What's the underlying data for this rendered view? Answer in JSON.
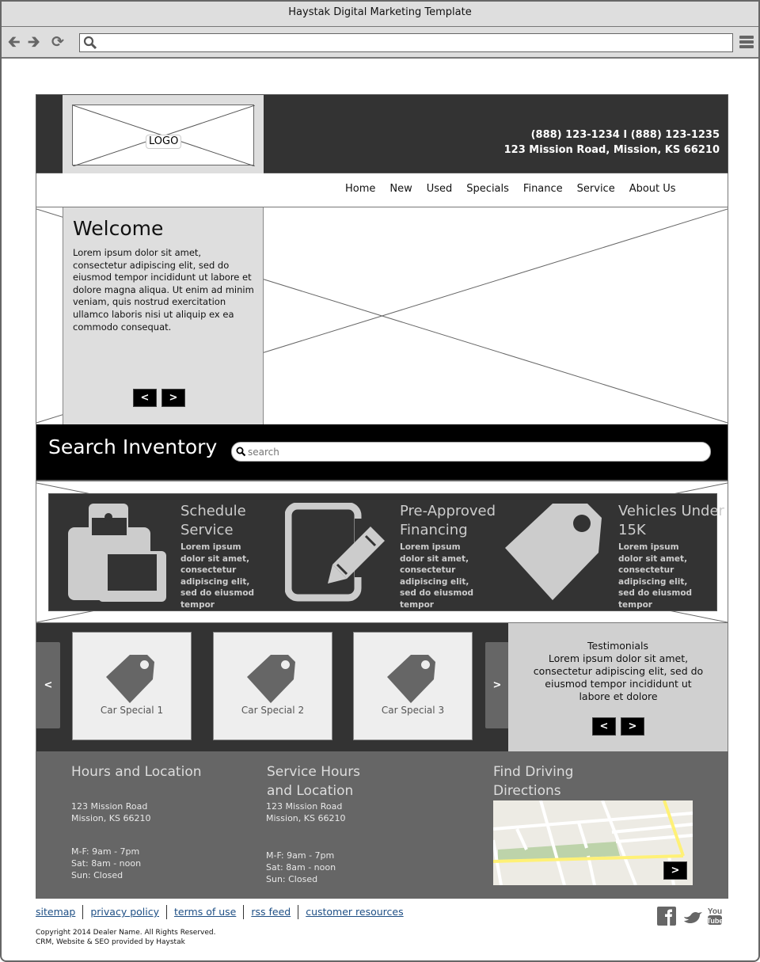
{
  "browser": {
    "title": "Haystak Digital Marketing Template",
    "url": ""
  },
  "header": {
    "logo_label": "LOGO",
    "phone": "(888) 123-1234 I (888) 123-1235",
    "address": "123 Mission Road, Mission, KS 66210"
  },
  "nav": {
    "items": [
      "Home",
      "New",
      "Used",
      "Specials",
      "Finance",
      "Service",
      "About Us"
    ]
  },
  "hero": {
    "title": "Welcome",
    "body": "Lorem ipsum dolor sit amet, consectetur adipiscing elit, sed do eiusmod tempor incididunt ut labore et dolore magna aliqua. Ut enim ad minim veniam, quis nostrud exercitation ullamco laboris nisi ut aliquip ex ea commodo consequat.",
    "prev_label": "<",
    "next_label": ">"
  },
  "search": {
    "title": "Search Inventory",
    "placeholder": "search",
    "value": ""
  },
  "features": [
    {
      "title": "Schedule Service",
      "body": "Lorem ipsum dolor sit amet, consectetur adipiscing elit, sed do eiusmod tempor",
      "icon": "clipboard-icon"
    },
    {
      "title": "Pre-Approved Financing",
      "body": "Lorem ipsum dolor sit amet, consectetur adipiscing elit, sed do eiusmod tempor",
      "icon": "edit-icon"
    },
    {
      "title": "Vehicles Under 15K",
      "body": "Lorem ipsum dolor sit amet, consectetur adipiscing elit, sed do eiusmod tempor",
      "icon": "price-tag-icon"
    }
  ],
  "specials": {
    "prev_label": "<",
    "next_label": ">",
    "items": [
      {
        "label": "Car Special 1"
      },
      {
        "label": "Car Special 2"
      },
      {
        "label": "Car Special 3"
      }
    ]
  },
  "testimonials": {
    "title": "Testimonials",
    "body": "Lorem ipsum dolor sit amet, consectetur adipiscing elit, sed do eiusmod tempor incididunt ut labore et dolore",
    "prev_label": "<",
    "next_label": ">"
  },
  "locations": [
    {
      "title": "Hours and Location",
      "address": [
        "123 Mission Road",
        "Mission, KS 66210"
      ],
      "hours": [
        "M-F: 9am - 7pm",
        "Sat: 8am - noon",
        "Sun: Closed"
      ]
    },
    {
      "title": "Service Hours and Location",
      "address": [
        "123 Mission Road",
        "Mission, KS 66210"
      ],
      "hours": [
        "M-F: 9am - 7pm",
        "Sat: 8am - noon",
        "Sun: Closed"
      ]
    }
  ],
  "directions": {
    "title": "Find Driving Directions",
    "go_label": ">"
  },
  "footer": {
    "links": [
      "sitemap",
      "privacy policy",
      "terms of use",
      "rss feed",
      "customer resources"
    ],
    "copyright": "Copyright 2014 Dealer Name. All Rights Reserved.",
    "credit": "CRM, Website & SEO provided by Haystak",
    "social": [
      "facebook-icon",
      "twitter-icon",
      "youtube-icon"
    ]
  },
  "colors": {
    "header_bg": "#333333",
    "search_bg": "#000000",
    "footer_bg": "#666666",
    "link": "#1e4f85",
    "map_route": "#fff176",
    "map_park": "#bdd3aa"
  }
}
